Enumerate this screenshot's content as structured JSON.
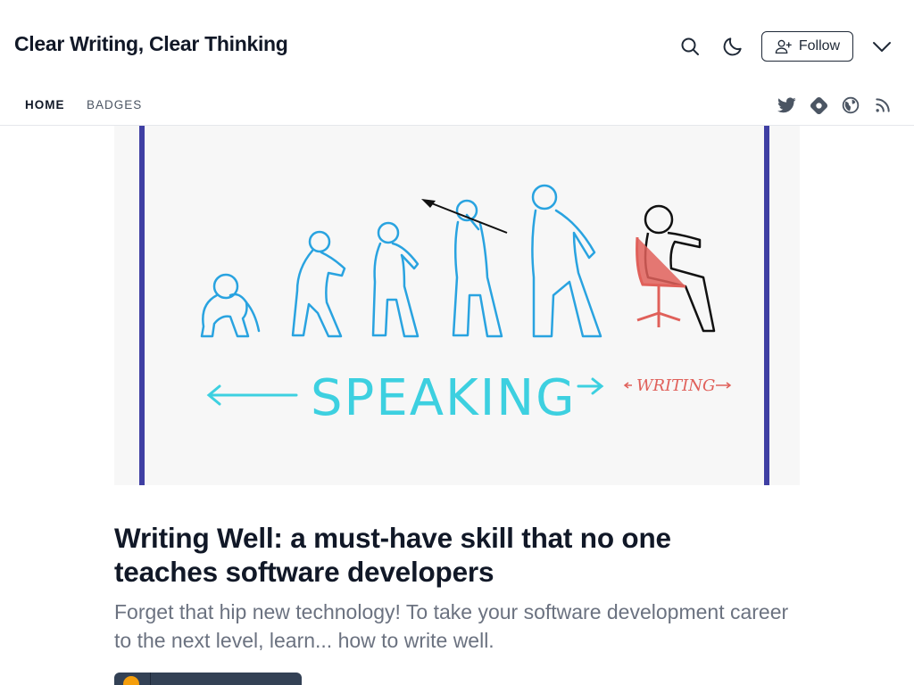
{
  "header": {
    "blog_title": "Clear Writing, Clear Thinking",
    "follow_label": "Follow",
    "icons": {
      "search": "search-icon",
      "theme": "moon-icon",
      "follow": "add-user-icon",
      "menu": "chevron-down-icon"
    }
  },
  "nav": {
    "tabs": [
      {
        "label": "HOME",
        "active": true
      },
      {
        "label": "BADGES",
        "active": false
      }
    ],
    "social": [
      "twitter-icon",
      "hashnode-icon",
      "globe-icon",
      "rss-icon"
    ]
  },
  "cover_image": {
    "speaking_text": "SPEAKING",
    "writing_text": "WRITING",
    "colors": {
      "border": "#3f3fa3",
      "figures": "#29a3e0",
      "speaking": "#3dd0e0",
      "writing": "#e0605a",
      "chair": "#e0605a"
    }
  },
  "post": {
    "title": "Writing Well: a must-have skill that no one teaches software developers",
    "subtitle": "Forget that hip new technology! To take your software development career to the next level, learn... how to write well."
  }
}
